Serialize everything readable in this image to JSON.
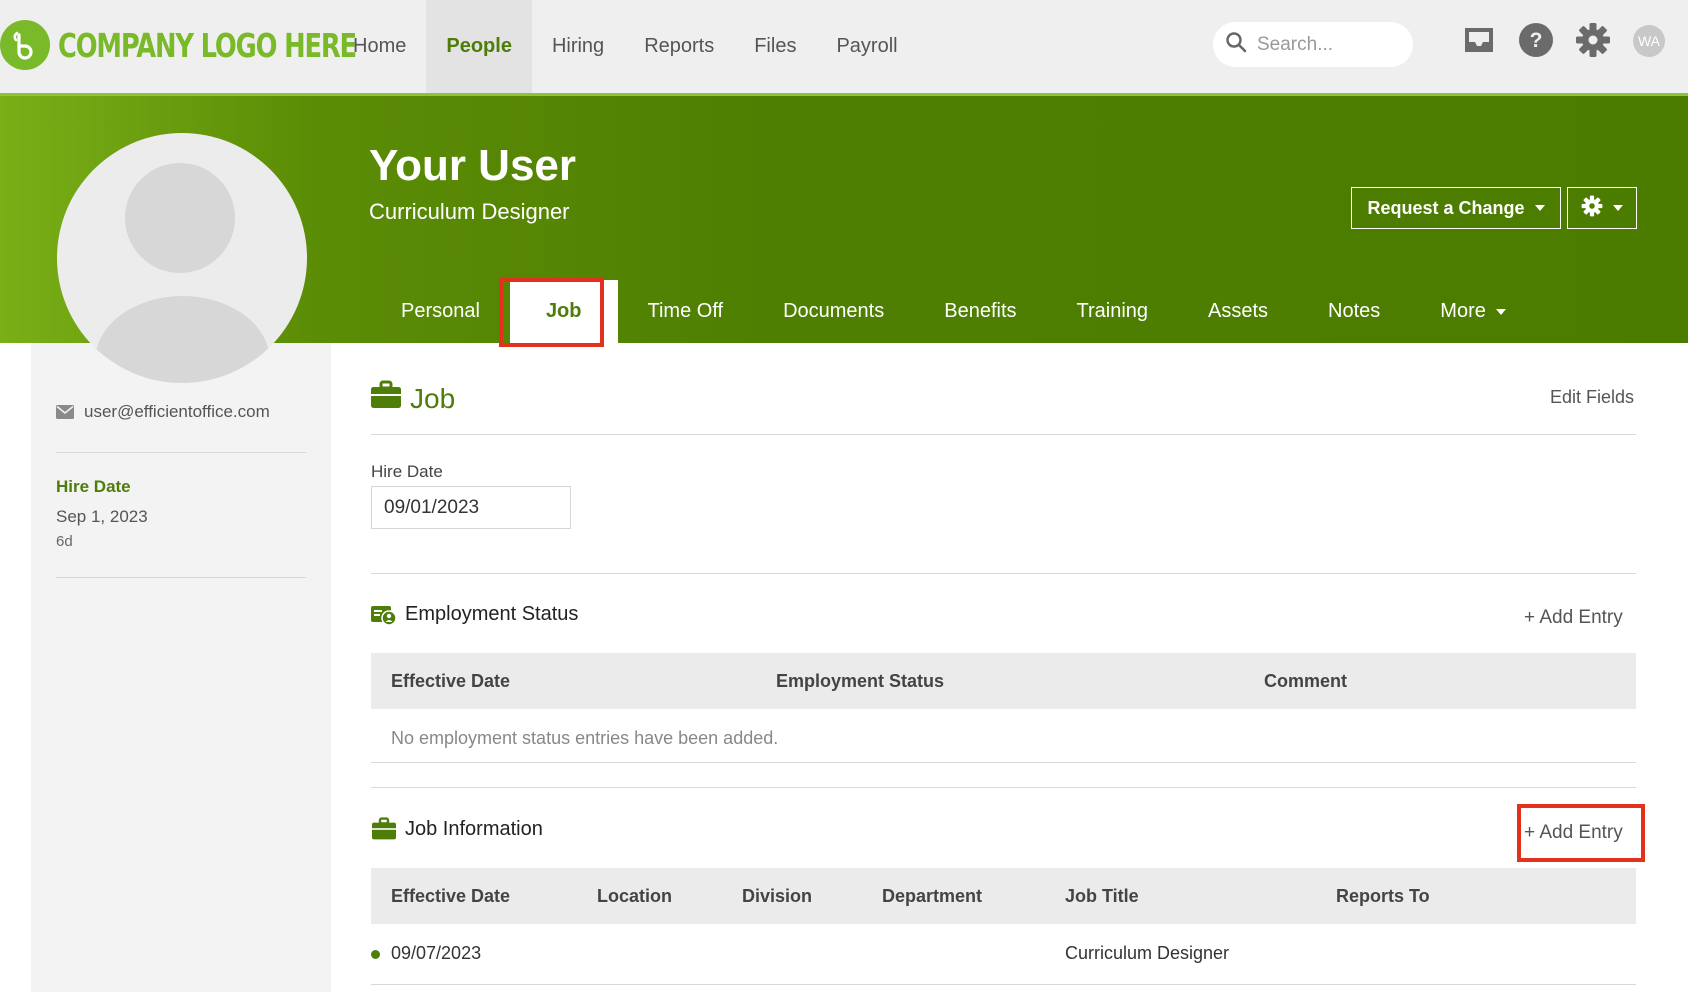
{
  "brand": {
    "logo_text": "COMPANY LOGO HERE",
    "logo_color": "#7ab929",
    "accent_color": "#4e7d09",
    "highlight_color": "#e4311c"
  },
  "topnav": {
    "items": [
      {
        "label": "Home",
        "active": false
      },
      {
        "label": "People",
        "active": true
      },
      {
        "label": "Hiring",
        "active": false
      },
      {
        "label": "Reports",
        "active": false
      },
      {
        "label": "Files",
        "active": false
      },
      {
        "label": "Payroll",
        "active": false
      }
    ],
    "search_placeholder": "Search...",
    "icons": [
      "search-icon",
      "inbox-icon",
      "help-icon",
      "settings-gear-icon"
    ],
    "user_initials": "WA"
  },
  "profile": {
    "name": "Your User",
    "job_title": "Curriculum Designer",
    "request_change_label": "Request a Change",
    "tabs": [
      {
        "label": "Personal",
        "active": false
      },
      {
        "label": "Job",
        "active": true
      },
      {
        "label": "Time Off",
        "active": false
      },
      {
        "label": "Documents",
        "active": false
      },
      {
        "label": "Benefits",
        "active": false
      },
      {
        "label": "Training",
        "active": false
      },
      {
        "label": "Assets",
        "active": false
      },
      {
        "label": "Notes",
        "active": false
      },
      {
        "label": "More",
        "active": false
      }
    ]
  },
  "sidebar": {
    "email": "user@efficientoffice.com",
    "hire_date_label": "Hire Date",
    "hire_date": "Sep 1, 2023",
    "tenure": "6d"
  },
  "job": {
    "section_title": "Job",
    "edit_fields_label": "Edit Fields",
    "hire_date_label": "Hire Date",
    "hire_date_value": "09/01/2023",
    "employment_status": {
      "title": "Employment Status",
      "add_entry_label": "+ Add Entry",
      "columns": [
        "Effective Date",
        "Employment Status",
        "Comment"
      ],
      "empty_message": "No employment status entries have been added."
    },
    "job_information": {
      "title": "Job Information",
      "add_entry_label": "+ Add Entry",
      "columns": [
        "Effective Date",
        "Location",
        "Division",
        "Department",
        "Job Title",
        "Reports To"
      ],
      "rows": [
        {
          "effective_date": "09/07/2023",
          "location": "",
          "division": "",
          "department": "",
          "job_title": "Curriculum Designer",
          "reports_to": ""
        }
      ]
    }
  }
}
